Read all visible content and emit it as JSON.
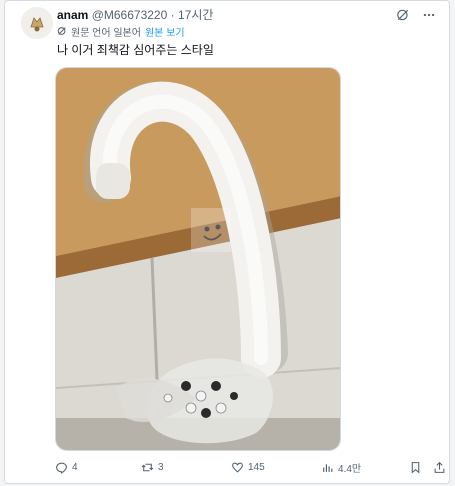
{
  "tweet": {
    "author_name": "anam",
    "handle": "@M66673220",
    "separator": "·",
    "time": "17시간",
    "translate_label": "원문 언어 일본어",
    "translate_link": "원본 보기",
    "text": "나 이거 죄책감 심어주는 스타일"
  },
  "actions": {
    "replies": "4",
    "reposts": "3",
    "likes": "145",
    "views": "4.4만"
  },
  "icons": [
    "grok-icon",
    "more-icon",
    "translate-icon",
    "reply-icon",
    "repost-icon",
    "like-icon",
    "views-icon",
    "bookmark-icon",
    "share-icon"
  ],
  "colors": {
    "accent": "#1d9bf0",
    "muted": "#536471",
    "text": "#0f1419"
  }
}
